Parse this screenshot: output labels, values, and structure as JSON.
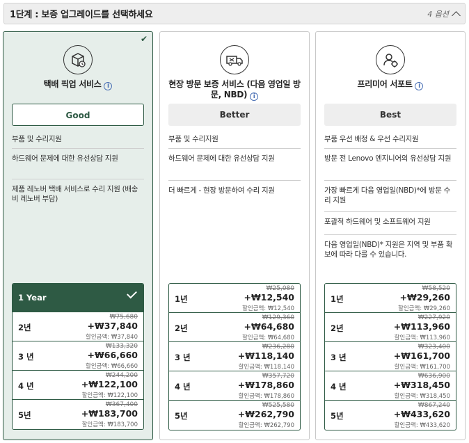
{
  "header": {
    "title": "1단계 : 보증 업그레이드를 선택하세요",
    "count": "4 옵션"
  },
  "colors": {
    "accent": "#2e5a44",
    "selected_bg": "#e6eeea"
  },
  "cards": [
    {
      "title": "택배 픽업 서비스",
      "icon": "box-pickup-icon",
      "tier": "Good",
      "selected": true,
      "features": [
        "부품 및 수리지원",
        "하드웨어 문제에 대한 유선상담 지원",
        "제품 레노버 택배 서비스로 수리 지원 (배송비 레노버 부담)"
      ],
      "years": [
        {
          "label": "1 Year",
          "active": true
        },
        {
          "label": "2년",
          "orig": "₩75,680",
          "price": "+₩37,840",
          "disc": "할인금액: ₩37,840"
        },
        {
          "label": "3 년",
          "orig": "₩133,320",
          "price": "+₩66,660",
          "disc": "할인금액: ₩66,660"
        },
        {
          "label": "4 년",
          "orig": "₩244,200",
          "price": "+₩122,100",
          "disc": "할인금액: ₩122,100"
        },
        {
          "label": "5년",
          "orig": "₩367,400",
          "price": "+₩183,700",
          "disc": "할인금액: ₩183,700"
        }
      ]
    },
    {
      "title": "현장 방문 보증 서비스 (다음 영업일 방문, NBD)",
      "icon": "onsite-truck-icon",
      "tier": "Better",
      "selected": false,
      "features": [
        "부품 및 수리지원",
        "하드웨어 문제에 대한 유선상담 지원",
        "더 빠르게 - 현장 방문하여 수리 지원"
      ],
      "years": [
        {
          "label": "1년",
          "orig": "₩25,080",
          "price": "+₩12,540",
          "disc": "할인금액: ₩12,540"
        },
        {
          "label": "2년",
          "orig": "₩129,360",
          "price": "+₩64,680",
          "disc": "할인금액: ₩64,680"
        },
        {
          "label": "3 년",
          "orig": "₩236,280",
          "price": "+₩118,140",
          "disc": "할인금액: ₩118,140"
        },
        {
          "label": "4 년",
          "orig": "₩357,720",
          "price": "+₩178,860",
          "disc": "할인금액: ₩178,860"
        },
        {
          "label": "5년",
          "orig": "₩525,580",
          "price": "+₩262,790",
          "disc": "할인금액: ₩262,790"
        }
      ]
    },
    {
      "title": "프리미어 서포트",
      "icon": "premier-support-icon",
      "tier": "Best",
      "selected": false,
      "features": [
        "부품 우선 배정 & 우선 수리지원",
        "방문 전 Lenovo 엔지니어의 유선상담 지원",
        "가장 빠르게 다음 영업일(NBD)*에 방문 수리 지원",
        "포괄적 하드웨어 및 소프트웨어 지원",
        "다음 영업일(NBD)* 지원은 지역 및 부품 확보에 따라 다를 수 있습니다."
      ],
      "years": [
        {
          "label": "1년",
          "orig": "₩58,520",
          "price": "+₩29,260",
          "disc": "할인금액: ₩29,260"
        },
        {
          "label": "2년",
          "orig": "₩227,920",
          "price": "+₩113,960",
          "disc": "할인금액: ₩113,960"
        },
        {
          "label": "3 년",
          "orig": "₩323,400",
          "price": "+₩161,700",
          "disc": "할인금액: ₩161,700"
        },
        {
          "label": "4 년",
          "orig": "₩636,900",
          "price": "+₩318,450",
          "disc": "할인금액: ₩318,450"
        },
        {
          "label": "5년",
          "orig": "₩867,240",
          "price": "+₩433,620",
          "disc": "할인금액: ₩433,620"
        }
      ]
    }
  ]
}
